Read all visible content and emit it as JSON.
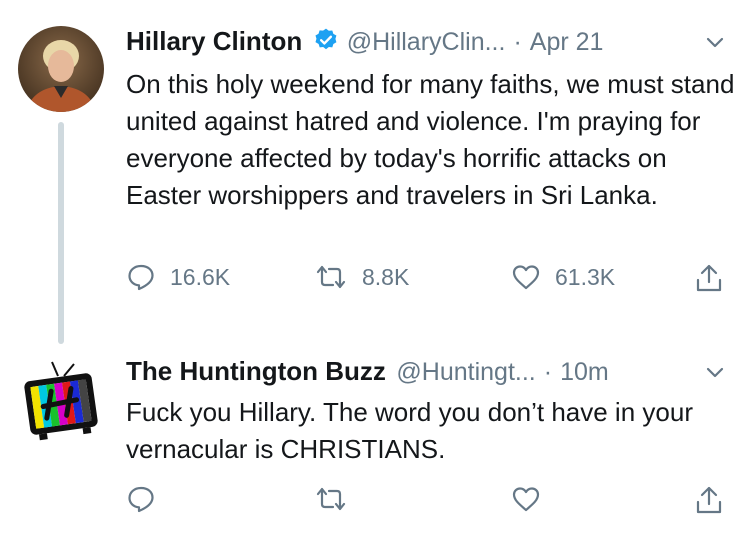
{
  "tweets": [
    {
      "author": "Hillary Clinton",
      "verified": true,
      "handle": "@HillaryClin...",
      "separator": "·",
      "time": "Apr 21",
      "text": "On this holy weekend for many faiths, we must stand united against hatred and violence. I'm praying for everyone affected by today's horrific attacks on Easter worshippers and travelers in Sri Lanka.",
      "replies": "16.6K",
      "retweets": "8.8K",
      "likes": "61.3K"
    },
    {
      "author": "The Huntington Buzz",
      "verified": false,
      "handle": "@Huntingt...",
      "separator": "·",
      "time": "10m",
      "text": "Fuck you Hillary. The word you don’t have in your vernacular is CHRISTIANS.",
      "replies": "",
      "retweets": "",
      "likes": ""
    }
  ],
  "colors": {
    "verified_blue": "#1da1f2",
    "secondary_text": "#657786",
    "thread_line": "#cfd9de"
  },
  "icons": [
    "reply-icon",
    "retweet-icon",
    "like-icon",
    "share-icon",
    "chevron-down-icon",
    "verified-badge-icon"
  ]
}
